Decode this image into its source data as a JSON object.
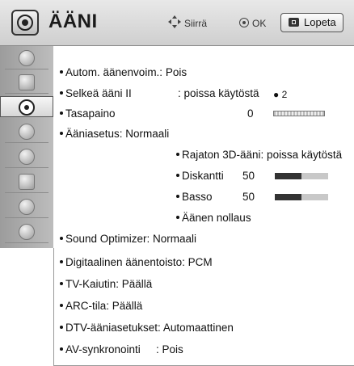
{
  "header": {
    "title": "ÄÄNI",
    "move_label": "Siirrä",
    "ok_label": "OK",
    "exit_label": "Lopeta"
  },
  "sidebar": {
    "items": [
      {
        "icon": "picture-icon"
      },
      {
        "icon": "screen-icon"
      },
      {
        "icon": "sound-icon",
        "active": true
      },
      {
        "icon": "time-icon"
      },
      {
        "icon": "lock-icon"
      },
      {
        "icon": "option-icon"
      },
      {
        "icon": "network-icon"
      },
      {
        "icon": "help-icon"
      }
    ]
  },
  "menu": {
    "auto_volume": "Autom. äänenvoim.: Pois",
    "clear_voice_label": "Selkeä ääni II",
    "clear_voice_value": ": poissa käytöstä",
    "clear_voice_level": "2",
    "balance_label": "Tasapaino",
    "balance_value": "0",
    "sound_setting": "Ääniasetus: Normaali",
    "infinite_3d": "Rajaton 3D-ääni: poissa käytöstä",
    "treble_label": "Diskantti",
    "treble_value": "50",
    "bass_label": "Basso",
    "bass_value": "50",
    "reset": "Äänen nollaus",
    "sound_optimizer": "Sound Optimizer: Normaali",
    "digital_output": "Digitaalinen äänentoisto: PCM",
    "tv_speaker": "TV-Kaiutin: Päällä",
    "arc": "ARC-tila: Päällä",
    "dtv_audio": "DTV-ääniasetukset: Automaattinen",
    "av_sync_label": "AV-synkronointi",
    "av_sync_value": ": Pois"
  },
  "levels": {
    "treble_fraction": 0.5,
    "bass_fraction": 0.5
  }
}
